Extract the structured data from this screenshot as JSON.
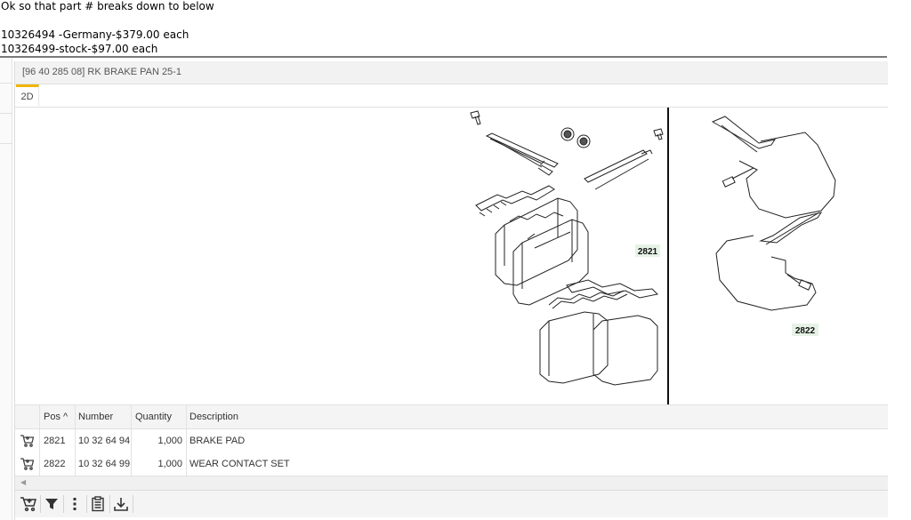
{
  "note": {
    "line1": "Ok so that part # breaks down to below",
    "line2": "10326494 -Germany-$379.00 each",
    "line3": "10326499-stock-$97.00 each"
  },
  "panel": {
    "title": "[96 40 285 08] RK BRAKE PAN 25-1",
    "tab_2d": "2D"
  },
  "drawing": {
    "callout_a": "2821",
    "callout_b": "2822"
  },
  "table": {
    "columns": {
      "pos": "Pos ^",
      "number": "Number",
      "quantity": "Quantity",
      "description": "Description"
    },
    "rows": [
      {
        "pos": "2821",
        "number": "10 32 64 94",
        "quantity": "1,000",
        "description": "BRAKE PAD"
      },
      {
        "pos": "2822",
        "number": "10 32 64 99",
        "quantity": "1,000",
        "description": "WEAR CONTACT SET"
      }
    ]
  },
  "icons": {
    "row_action": "cart-icon",
    "toolbar": [
      "cart-icon",
      "filter-icon",
      "more-vertical-icon",
      "clipboard-icon",
      "download-icon"
    ]
  }
}
